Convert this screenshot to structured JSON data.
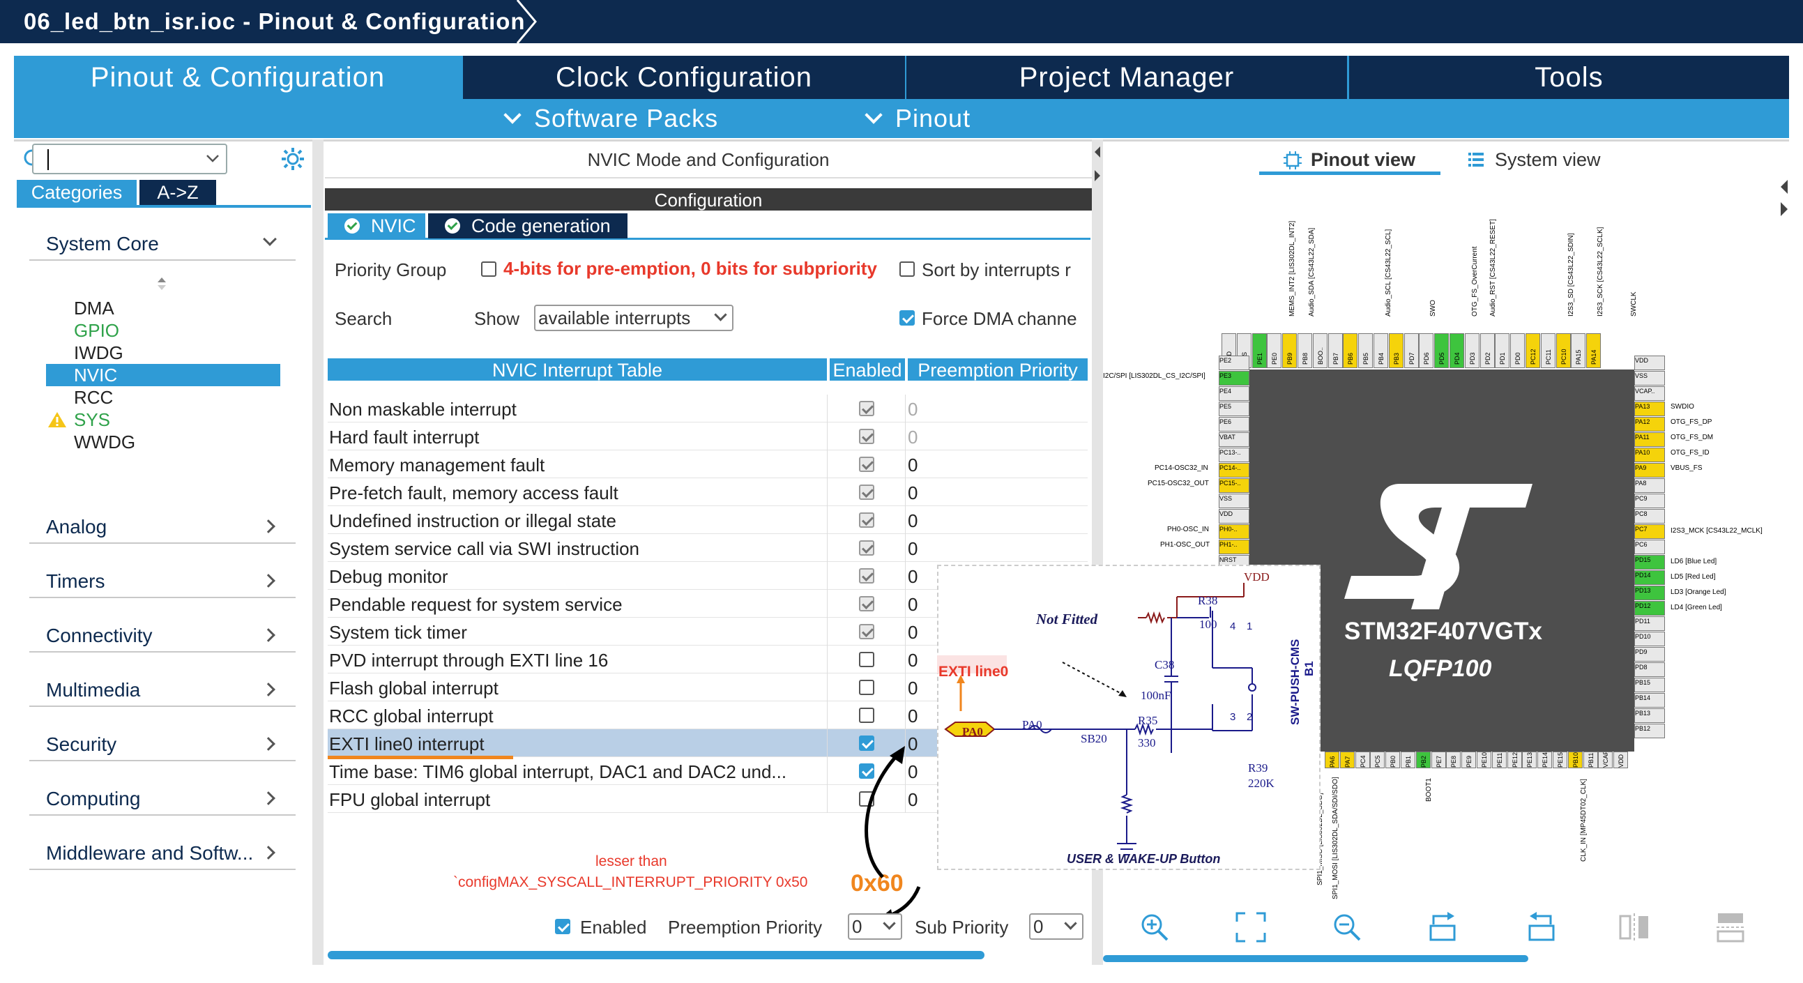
{
  "window": {
    "title": "06_led_btn_isr.ioc - Pinout & Configuration"
  },
  "main_tabs": [
    "Pinout & Configuration",
    "Clock Configuration",
    "Project Manager",
    "Tools"
  ],
  "sub_tabs": [
    "Software Packs",
    "Pinout"
  ],
  "left": {
    "search": {
      "value": "",
      "placeholder": ""
    },
    "cat_tabs": [
      "Categories",
      "A->Z"
    ],
    "system_core": {
      "label": "System Core",
      "items": [
        "DMA",
        "GPIO",
        "IWDG",
        "NVIC",
        "RCC",
        "SYS",
        "WWDG"
      ]
    },
    "sections": [
      "Analog",
      "Timers",
      "Connectivity",
      "Multimedia",
      "Security",
      "Computing",
      "Middleware and Softw..."
    ]
  },
  "middle": {
    "header": "NVIC Mode and Configuration",
    "config_label": "Configuration",
    "tabs": [
      "NVIC",
      "Code generation"
    ],
    "priority_group_label": "Priority Group",
    "priority_group_value": "4-bits for pre-emption, 0 bits for subpriority",
    "sort_label": "Sort by interrupts r",
    "search_label": "Search",
    "show_label": "Show",
    "show_value": "available interrupts",
    "force_dma_label": "Force DMA channe",
    "table": {
      "headers": [
        "NVIC Interrupt Table",
        "Enabled",
        "Preemption Priority"
      ],
      "rows": [
        {
          "name": "Non maskable interrupt",
          "enabled": true,
          "prio": "0"
        },
        {
          "name": "Hard fault interrupt",
          "enabled": true,
          "prio": "0"
        },
        {
          "name": "Memory management fault",
          "enabled": true,
          "prio": "0"
        },
        {
          "name": "Pre-fetch fault, memory access fault",
          "enabled": true,
          "prio": "0"
        },
        {
          "name": "Undefined instruction or illegal state",
          "enabled": true,
          "prio": "0"
        },
        {
          "name": "System service call via SWI instruction",
          "enabled": true,
          "prio": "0"
        },
        {
          "name": "Debug monitor",
          "enabled": true,
          "prio": "0"
        },
        {
          "name": "Pendable request for system service",
          "enabled": true,
          "prio": "0"
        },
        {
          "name": "System tick timer",
          "enabled": true,
          "prio": "0"
        },
        {
          "name": "PVD interrupt through EXTI line 16",
          "enabled": false,
          "prio": "0"
        },
        {
          "name": "Flash global interrupt",
          "enabled": false,
          "prio": "0"
        },
        {
          "name": "RCC global interrupt",
          "enabled": false,
          "prio": "0"
        },
        {
          "name": "EXTI line0 interrupt",
          "enabled": true,
          "prio": "0"
        },
        {
          "name": "Time base: TIM6 global interrupt, DAC1 and DAC2 und...",
          "enabled": true,
          "prio": "0"
        },
        {
          "name": "FPU global interrupt",
          "enabled": false,
          "prio": "0"
        }
      ]
    },
    "annotation": {
      "line1": "lesser than",
      "line2": "`configMAX_SYSCALL_INTERRUPT_PRIORITY 0x50",
      "hex": "0x60"
    },
    "bottom": {
      "enabled_label": "Enabled",
      "preemption_label": "Preemption Priority",
      "preemption_value": "0",
      "sub_label": "Sub Priority",
      "sub_value": "0"
    }
  },
  "right": {
    "tabs": [
      "Pinout view",
      "System view"
    ],
    "chip": {
      "name": "STM32F407VGTx",
      "package": "LQFP100"
    },
    "top_pins": [
      "VDD",
      "VSS",
      "PE1",
      "PE0",
      "PB9",
      "PB8",
      "BOO..",
      "PB7",
      "PB6",
      "PB5",
      "PB4",
      "PB3",
      "PD7",
      "PD6",
      "PD5",
      "PD4",
      "PD3",
      "PD2",
      "PD1",
      "PD0",
      "PC12",
      "PC11",
      "PC10",
      "PA15",
      "PA14"
    ],
    "top_labels": [
      "MEMS_INT2 [LIS302DL_INT2]",
      "Audio_SDA [CS43L22_SDA]",
      "Audio_SCL [CS43L22_SCL]",
      "SWO",
      "OTG_FS_OverCurrent",
      "Audio_RST [CS43L22_RESET]",
      "I2S3_SD [CS43L22_SDIN]",
      "I2S3_SCK [CS43L22_SCLK]",
      "SWCLK"
    ],
    "left_pins": [
      "PE2",
      "PE3",
      "PE4",
      "PE5",
      "PE6",
      "VBAT",
      "PC13-..",
      "PC14-..",
      "PC15-..",
      "VSS",
      "VDD",
      "PH0-..",
      "PH1-..",
      "NRST"
    ],
    "left_labels": [
      "I2C/SPI [LIS302DL_CS_I2C/SPI]",
      "PC14-OSC32_IN",
      "PC15-OSC32_OUT",
      "PH0-OSC_IN",
      "PH1-OSC_OUT"
    ],
    "right_pins": [
      "VDD",
      "VSS",
      "VCAP..",
      "PA13",
      "PA12",
      "PA11",
      "PA10",
      "PA9",
      "PA8",
      "PC9",
      "PC8",
      "PC7",
      "PC6",
      "PD15",
      "PD14",
      "PD13",
      "PD12",
      "PD11",
      "PD10",
      "PD9",
      "PD8",
      "PB15",
      "PB14",
      "PB13",
      "PB12"
    ],
    "right_labels": [
      "SWDIO",
      "OTG_FS_DP",
      "OTG_FS_DM",
      "OTG_FS_ID",
      "VBUS_FS",
      "I2S3_MCK [CS43L22_MCLK]",
      "LD6 [Blue Led]",
      "LD5 [Red Led]",
      "LD3 [Orange Led]",
      "LD4 [Green Led]"
    ],
    "bottom_pins": [
      "PA6",
      "PA7",
      "PC4",
      "PC5",
      "PB0",
      "PB1",
      "PB2",
      "PE7",
      "PE8",
      "PE9",
      "PE10",
      "PE11",
      "PE12",
      "PE13",
      "PE14",
      "PE15",
      "PB10",
      "PB11",
      "VCAP..",
      "VDD"
    ],
    "bottom_labels": [
      "SPI1_MISO [LIS302DL_SDO]",
      "SPI1_MOSI [LIS302DL_SDA/SDI/SDO]",
      "BOOT1",
      "CLK_IN [MP45DT02_CLK]"
    ],
    "schematic": {
      "vdd": "VDD",
      "r38": "R38",
      "r38v": "100",
      "not_fitted": "Not Fitted",
      "c38": "C38",
      "c38v": "100nF",
      "exti": "EXTI line0",
      "pa0_port": "PA0",
      "pa0_net": "PA0",
      "sb20": "SB20",
      "r35": "R35",
      "r35v": "330",
      "r39": "R39",
      "r39v": "220K",
      "switch": "SW-PUSH-CMS",
      "b1": "B1",
      "pin4": "4",
      "pin1": "1",
      "pin3": "3",
      "pin2": "2",
      "caption": "USER & WAKE-UP Button"
    }
  },
  "colors": {
    "navy": "#0d2a4f",
    "blue": "#2f9bd6",
    "red": "#e8392b",
    "orange": "#f0861e",
    "green": "#2fa24a"
  }
}
